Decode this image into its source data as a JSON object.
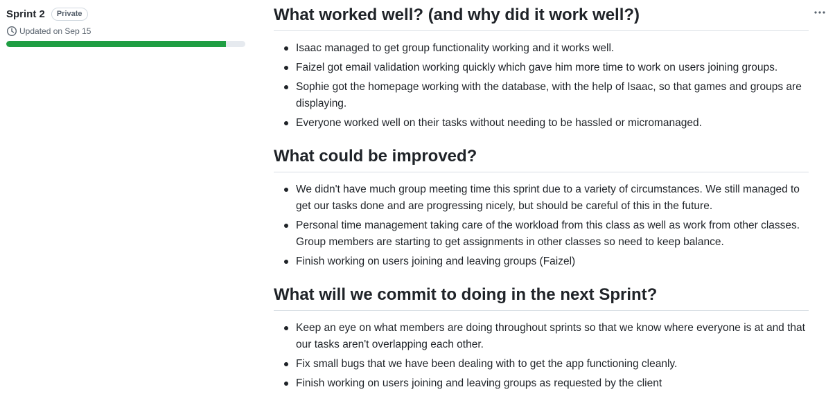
{
  "project": {
    "title": "Sprint 2",
    "visibility": "Private",
    "updated": "Updated on Sep 15",
    "progress_percent": 92
  },
  "sections": [
    {
      "heading": "What worked well? (and why did it work well?)",
      "items": [
        "Isaac managed to get group functionality working and it works well.",
        "Faizel got email validation working quickly which gave him more time to work on users joining groups.",
        "Sophie got the homepage working with the database, with the help of Isaac, so that games and groups are displaying.",
        "Everyone worked well on their tasks without needing to be hassled or micromanaged."
      ]
    },
    {
      "heading": "What could be improved?",
      "items": [
        "We didn't have much group meeting time this sprint due to a variety of circumstances. We still managed to get our tasks done and are progressing nicely, but should be careful of this in the future.",
        "Personal time management taking care of the workload from this class as well as work from other classes. Group members are starting to get assignments in other classes so need to keep balance.",
        "Finish working on users joining and leaving groups (Faizel)"
      ]
    },
    {
      "heading": "What will we commit to doing in the next Sprint?",
      "items": [
        "Keep an eye on what members are doing throughout sprints so that we know where everyone is at and that our tasks aren't overlapping each other.",
        "Fix small bugs that we have been dealing with to get the app functioning cleanly.",
        "Finish working on users joining and leaving groups as requested by the client"
      ]
    }
  ],
  "icons": {
    "clock": "clock-icon",
    "more": "kebab-horizontal-icon"
  },
  "colors": {
    "progress_fill": "#1f9e43",
    "progress_track": "#e6eaef"
  }
}
